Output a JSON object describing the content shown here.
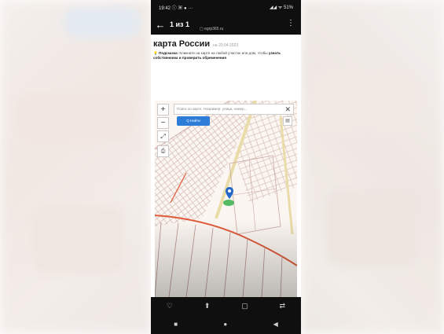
{
  "status_bar": {
    "time": "19:42 ⓘ ▣ ●  ···",
    "icons": "◢◢ ᯤ 51%"
  },
  "app_bar": {
    "title": "1 из 1",
    "subtitle": "▢ egrp365.ru"
  },
  "page": {
    "heading": "карта России",
    "date": "на 20.04.2023"
  },
  "hint": {
    "label": "Подсказка:",
    "text": "Кликните на карте на любой участок или дом, чтобы ",
    "bold": "узнать собственника и проверить обременения"
  },
  "map": {
    "search_placeholder": "Поиск по карте. Например: улица, номер...",
    "search_button": "Q Найти",
    "zoom_in": "+",
    "zoom_out": "−",
    "fullscreen": "⤢",
    "print": "⎙",
    "close": "✕",
    "layers": "▤",
    "colors": {
      "plot_lines": "#c9a8a0",
      "highlight": "#e05a3a",
      "road": "#eadca8",
      "marker_blue": "#2468c9",
      "marker_green": "#35b04a"
    }
  },
  "nav": {
    "row1": [
      "♡",
      "⬆",
      "▢",
      "⇄"
    ],
    "row2": [
      "■",
      "●",
      "◀"
    ]
  }
}
